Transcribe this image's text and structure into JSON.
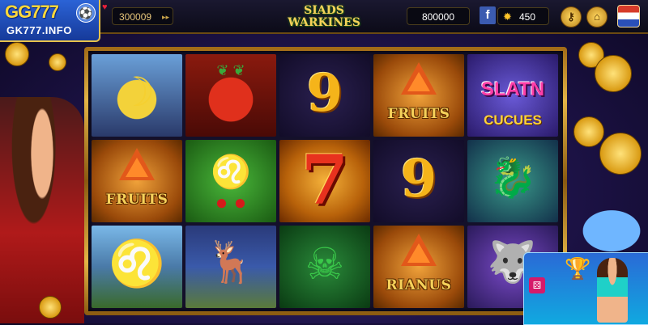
{
  "header": {
    "logo_text": "GG777",
    "logo_site": "GK777.INFO",
    "jackpot_value": "300009",
    "game_title_line1": "SIADS",
    "game_title_line2": "WARKINES",
    "credit_value": "800000",
    "coins_value": "450"
  },
  "reels": [
    {
      "name": "banana",
      "label": ""
    },
    {
      "name": "strawberry",
      "label": ""
    },
    {
      "name": "nine",
      "label": "9"
    },
    {
      "name": "fruits-triangle",
      "label": "FRUITS"
    },
    {
      "name": "slatin-cucues",
      "label": "SLATN",
      "sub": "CUCUES"
    },
    {
      "name": "fruits-triangle",
      "label": "FRUITS"
    },
    {
      "name": "lion-cherries",
      "label": ""
    },
    {
      "name": "seven",
      "label": "7"
    },
    {
      "name": "nine",
      "label": "9"
    },
    {
      "name": "dragon-creature",
      "label": ""
    },
    {
      "name": "lion",
      "label": ""
    },
    {
      "name": "deer",
      "label": ""
    },
    {
      "name": "green-demon",
      "label": ""
    },
    {
      "name": "rianos-triangle",
      "label": "RIANUS"
    },
    {
      "name": "wolf-warrior",
      "label": ""
    }
  ],
  "colors": {
    "gold": "#e3b446",
    "background": "#1c1245",
    "accent_red": "#e8321e"
  }
}
